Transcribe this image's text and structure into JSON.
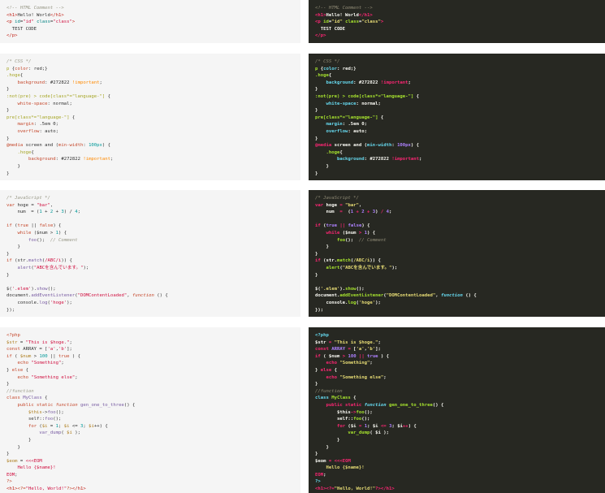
{
  "html": {
    "line1": "<!-- HTML Comment -->",
    "line2": "<h1>Hello! World</h1>",
    "line3": "<p id=\"id\" class=\"class\">",
    "line4": "  TEST CODE",
    "line5": "</p>"
  },
  "css": {
    "lines": [
      "/* CSS */",
      "p {color: red;}",
      ".hoge{",
      "    background: #272822 !important;",
      "}",
      ":not(pre) > code[class*=\"language-\"] {",
      "    white-space: normal;",
      "}",
      "pre[class*=\"language-\"] {",
      "    margin: .5em 0;",
      "    overflow: auto;",
      "}",
      "@media screen and (min-width: 100px) {",
      "    .hoge{",
      "        background: #272822 !important;",
      "    }",
      "}"
    ]
  },
  "js": {
    "lines": [
      "/* JavaScript */",
      "var hoge = \"bar\",",
      "    num  = (1 + 2 + 3) / 4;",
      "",
      "if (true || false) {",
      "    while ($num > 1) {",
      "        foo();  // Comment",
      "    }",
      "}",
      "if (str.match(/ABC/i)) {",
      "    alert(\"ABCを含んでいます。\");",
      "}",
      "",
      "$('.elem').show();",
      "document.addEventListener(\"DOMContentLoaded\", function () {",
      "    console.log('hoge');",
      "});"
    ]
  },
  "php": {
    "lines": [
      "<?php",
      "$str = \"This is $hoge.\";",
      "const ARRAY = ['a','b'];",
      "if ( $num > 100 || true ) {",
      "    echo \"Something\";",
      "} else {",
      "    echo \"Something else\";",
      "}",
      "//function",
      "class MyClass {",
      "    public static function gen_one_to_three() {",
      "        $this->foo();",
      "        self::foo();",
      "        for ($i = 1; $i <= 3; $i++) {",
      "            var_dump( $i );",
      "        }",
      "    }",
      "}",
      "$eom = <<<EOM",
      "    Hello {$name}!",
      "EOM;",
      "?>",
      "<h1><?=\"Hello, World!\"?></h1>"
    ]
  }
}
